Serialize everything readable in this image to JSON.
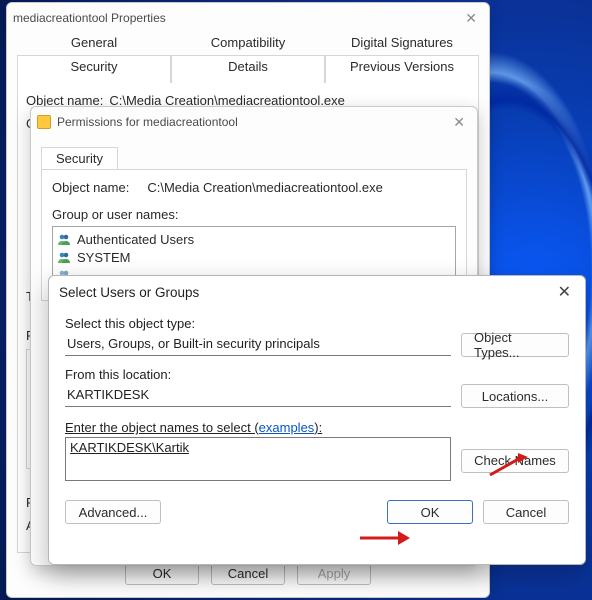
{
  "properties_window": {
    "title": "mediacreationtool Properties",
    "tabs_row1": [
      "General",
      "Compatibility",
      "Digital Signatures"
    ],
    "tabs_row2": [
      "Security",
      "Details",
      "Previous Versions"
    ],
    "object_name_label": "Object name:",
    "object_name_value": "C:\\Media Creation\\mediacreationtool.exe",
    "group_label_trunc": "Gr",
    "permissions_for_prefix": "To",
    "permissions_panel_prefix": "Pe",
    "special_prefix_line1": "Fo",
    "special_prefix_line2": "Ad",
    "buttons": {
      "ok": "OK",
      "cancel": "Cancel",
      "apply": "Apply"
    }
  },
  "permissions_window": {
    "title": "Permissions for mediacreationtool",
    "tab": "Security",
    "object_name_label": "Object name:",
    "object_name_value": "C:\\Media Creation\\mediacreationtool.exe",
    "group_label": "Group or user names:",
    "users": [
      "Authenticated Users",
      "SYSTEM"
    ]
  },
  "select_window": {
    "title": "Select Users or Groups",
    "object_type_label": "Select this object type:",
    "object_type_value": "Users, Groups, or Built-in security principals",
    "object_types_btn": "Object Types...",
    "location_label": "From this location:",
    "location_value": "KARTIKDESK",
    "locations_btn": "Locations...",
    "names_label_prefix": "Enter the object names to select (",
    "names_label_link": "examples",
    "names_label_suffix": "):",
    "names_value": "KARTIKDESK\\Kartik",
    "check_names_btn": "Check Names",
    "advanced_btn": "Advanced...",
    "ok_btn": "OK",
    "cancel_btn": "Cancel"
  }
}
